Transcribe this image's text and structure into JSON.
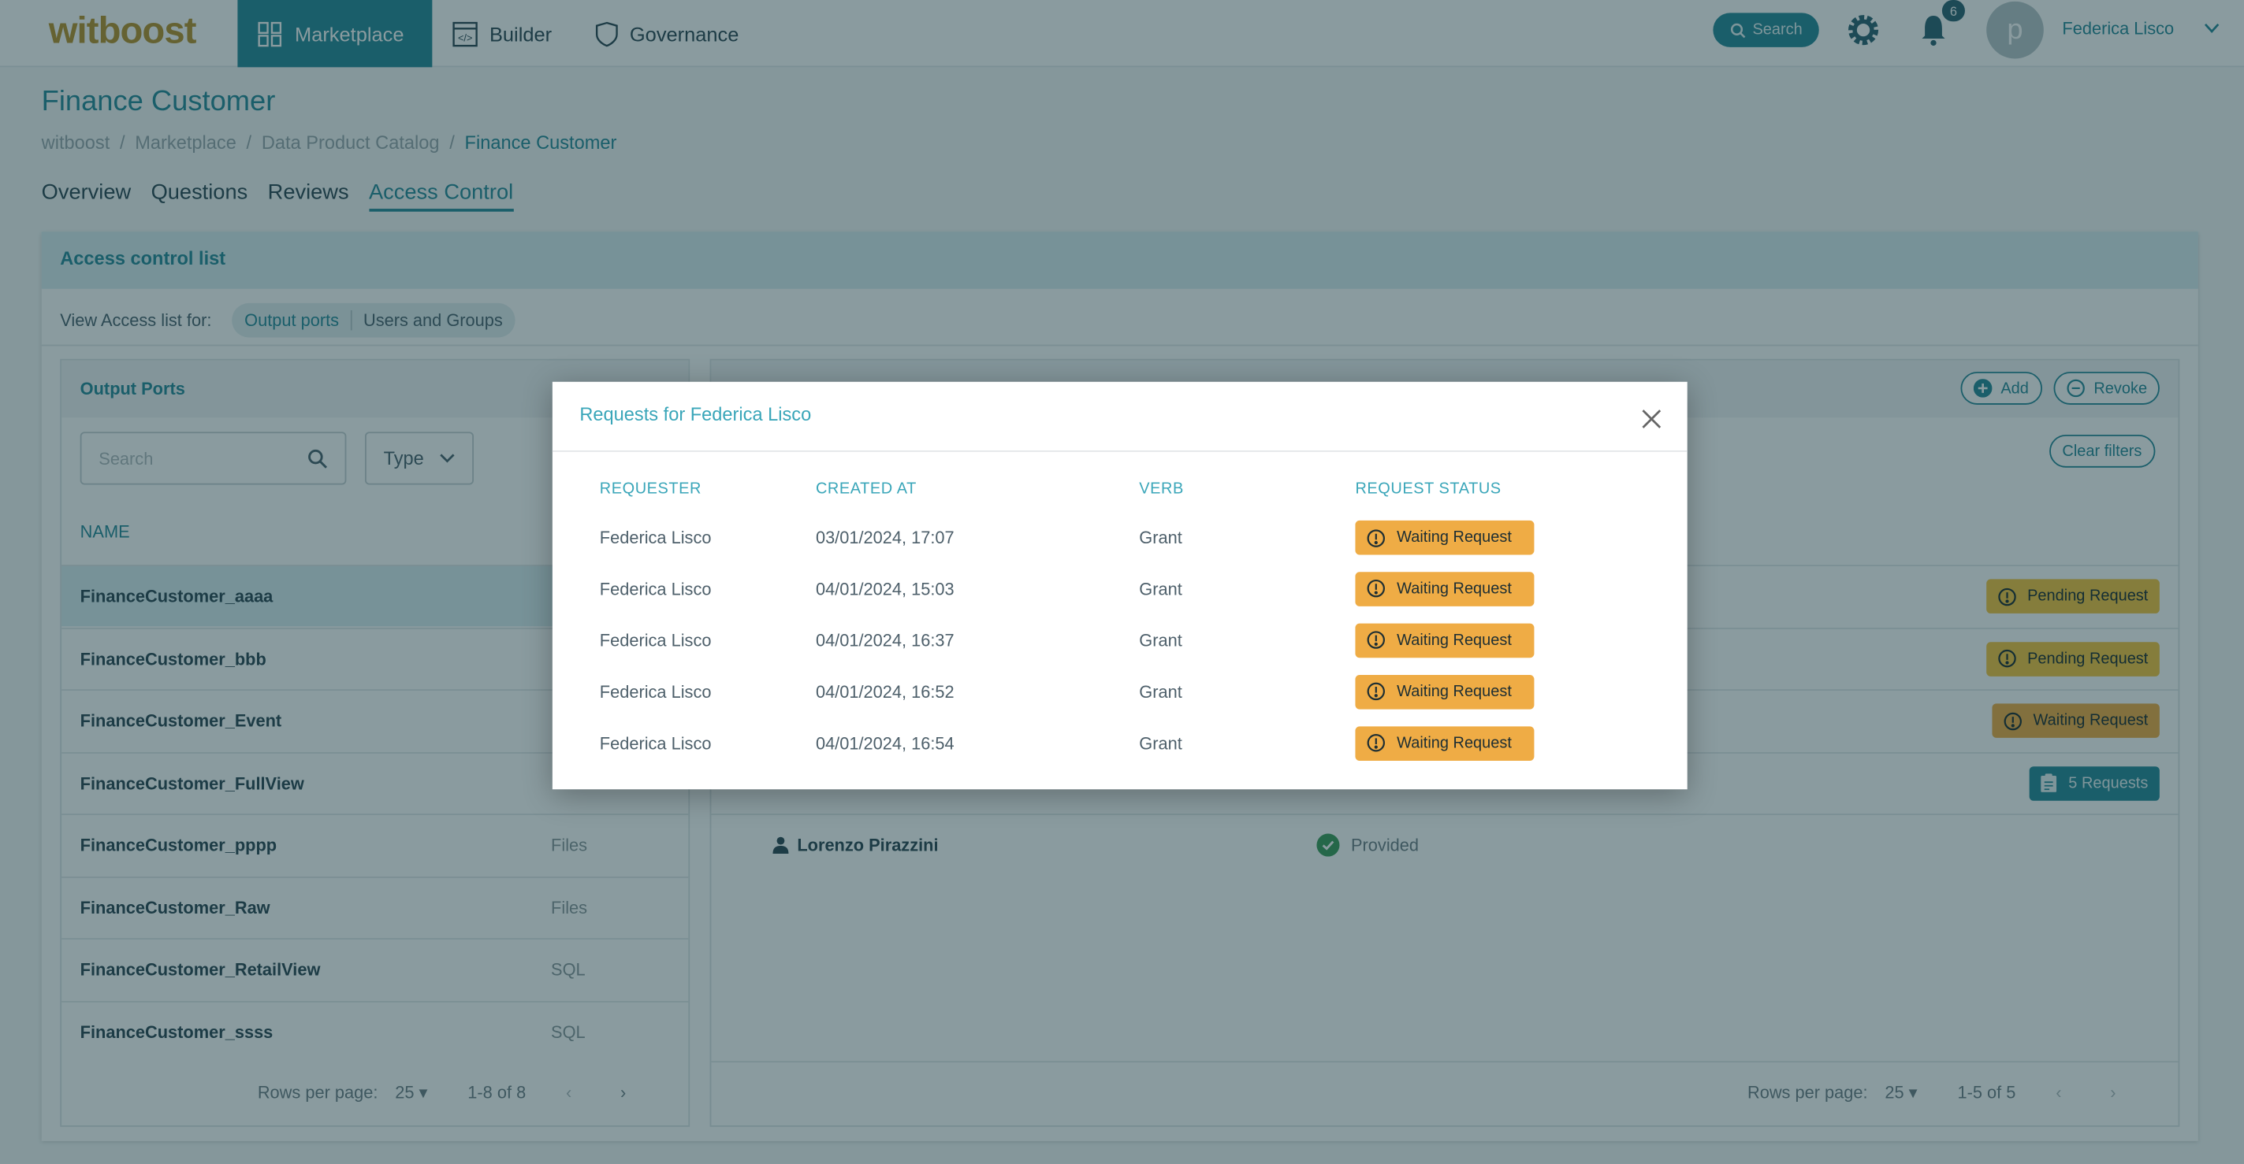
{
  "topbar": {
    "logo": "witboost",
    "nav": [
      {
        "label": "Marketplace",
        "icon": "marketplace-grid-icon",
        "active": true
      },
      {
        "label": "Builder",
        "icon": "code-window-icon"
      },
      {
        "label": "Governance",
        "icon": "shield-icon"
      }
    ],
    "search_label": "Search",
    "notification_count": "6",
    "avatar_letter": "p",
    "user_name": "Federica Lisco"
  },
  "page": {
    "title": "Finance Customer",
    "breadcrumbs": [
      "witboost",
      "Marketplace",
      "Data Product Catalog",
      "Finance Customer"
    ],
    "tabs": [
      "Overview",
      "Questions",
      "Reviews",
      "Access Control"
    ],
    "active_tab": "Access Control"
  },
  "acl": {
    "title": "Access control list",
    "view_for_label": "View Access list for:",
    "toggle": [
      "Output ports",
      "Users and Groups"
    ]
  },
  "output_ports": {
    "title": "Output Ports",
    "search_placeholder": "Search",
    "type_filter": "Type",
    "name_header": "NAME",
    "rows": [
      {
        "name": "FinanceCustomer_aaaa",
        "type": ""
      },
      {
        "name": "FinanceCustomer_bbb",
        "type": ""
      },
      {
        "name": "FinanceCustomer_Event",
        "type": ""
      },
      {
        "name": "FinanceCustomer_FullView",
        "type": ""
      },
      {
        "name": "FinanceCustomer_pppp",
        "type": "Files"
      },
      {
        "name": "FinanceCustomer_Raw",
        "type": "Files"
      },
      {
        "name": "FinanceCustomer_RetailView",
        "type": "SQL"
      },
      {
        "name": "FinanceCustomer_ssss",
        "type": "SQL"
      }
    ],
    "pager": {
      "rows_label": "Rows per page:",
      "rows": "25",
      "range": "1-8 of 8"
    }
  },
  "users": {
    "add": "Add",
    "revoke": "Revoke",
    "clear_filters": "Clear filters",
    "rows": [
      {
        "status": "Pending Request"
      },
      {
        "status": "Pending Request"
      },
      {
        "status": "Waiting Request"
      },
      {
        "status": "5 Requests"
      },
      {
        "user": "Lorenzo Pirazzini",
        "access": "Provided"
      }
    ],
    "pager": {
      "rows_label": "Rows per page:",
      "rows": "25",
      "range": "1-5 of 5"
    }
  },
  "modal": {
    "title": "Requests for Federica Lisco",
    "headers": [
      "REQUESTER",
      "CREATED AT",
      "VERB",
      "REQUEST STATUS"
    ],
    "rows": [
      {
        "requester": "Federica Lisco",
        "created": "03/01/2024, 17:07",
        "verb": "Grant",
        "status": "Waiting Request"
      },
      {
        "requester": "Federica Lisco",
        "created": "04/01/2024, 15:03",
        "verb": "Grant",
        "status": "Waiting Request"
      },
      {
        "requester": "Federica Lisco",
        "created": "04/01/2024, 16:37",
        "verb": "Grant",
        "status": "Waiting Request"
      },
      {
        "requester": "Federica Lisco",
        "created": "04/01/2024, 16:52",
        "verb": "Grant",
        "status": "Waiting Request"
      },
      {
        "requester": "Federica Lisco",
        "created": "04/01/2024, 16:54",
        "verb": "Grant",
        "status": "Waiting Request"
      }
    ]
  },
  "colors": {
    "accent": "#2a8a99",
    "waiting": "#efac45",
    "pending": "#f5c542",
    "provided": "#3e9b5a",
    "logo": "#b8932e"
  }
}
